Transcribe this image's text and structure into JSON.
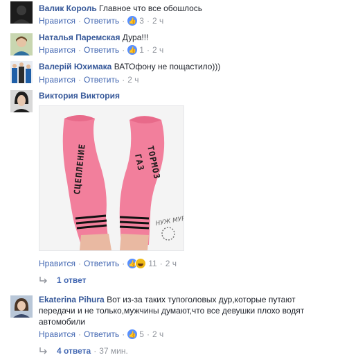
{
  "comments": [
    {
      "name": "Валик Король",
      "text": "Главное что все обошлось",
      "like": "Нравится",
      "reply": "Ответить",
      "reactions": "3",
      "time": "2 ч"
    },
    {
      "name": "Наталья Паремская",
      "text": "Дура!!!",
      "like": "Нравится",
      "reply": "Ответить",
      "reactions": "1",
      "time": "2 ч"
    },
    {
      "name": "Валерій Юхимака",
      "text": "ВАТОфону не пощастило)))",
      "like": "Нравится",
      "reply": "Ответить",
      "time": "2 ч"
    },
    {
      "name": "Виктория Виктория",
      "text": "",
      "like": "Нравится",
      "reply": "Ответить",
      "reactions": "11",
      "time": "2 ч",
      "replies_label": "1 ответ",
      "image": {
        "left_sock_text": "СЦЕПЛЕНИЕ",
        "right_sock_text_1": "ГАЗ",
        "right_sock_text_2": "ТОРМОЗ",
        "watermark": "НУЖ МУРУ"
      }
    },
    {
      "name": "Ekaterina Pihura",
      "text_line1": "Вот из-за таких тупоголовых дур,которые путают",
      "text_line2": "передачи и не только,мужчины думают,что все девушки плохо водят",
      "text_line3": "автомобили",
      "like": "Нравится",
      "reply": "Ответить",
      "reactions": "5",
      "time": "2 ч",
      "replies_label": "4 ответа",
      "replies_time": "37 мин."
    }
  ],
  "colors": {
    "name": "#365899",
    "link": "#4267b2",
    "meta": "#90949c",
    "like_blue": "#5890ff",
    "haha_yellow": "#f0ba15",
    "sock_pink": "#f27f9c"
  },
  "icons": {
    "like": "thumbs-up-icon",
    "haha": "haha-reaction-icon",
    "reply_arrow": "reply-arrow-icon"
  }
}
